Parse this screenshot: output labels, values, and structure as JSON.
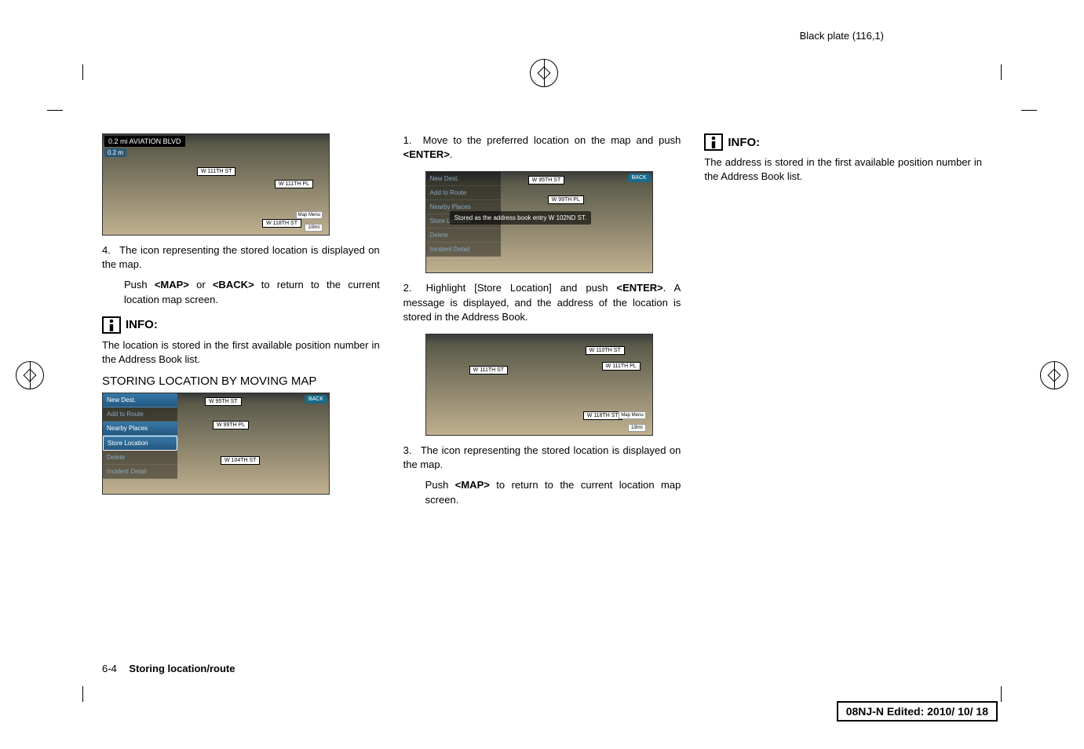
{
  "header": {
    "black_plate": "Black plate (116,1)"
  },
  "col1": {
    "shot1": {
      "hdr": "0.2 mi   AVIATION BLVD",
      "sub": "0.2 m",
      "street1": "W 111TH ST",
      "street2": "W 111TH PL",
      "street3": "W 118TH ST",
      "mapmenu": "Map\nMenu",
      "scale": "1/8mi"
    },
    "step4": {
      "num": "4.",
      "text": "The icon representing the stored location is displayed on the map.",
      "text2a": "Push ",
      "map": "<MAP>",
      "text2b": " or ",
      "back": "<BACK>",
      "text2c": " to return to the current location map screen."
    },
    "info": {
      "label": "INFO:",
      "text": "The location is stored in the first available position number in the Address Book list."
    },
    "heading": "STORING LOCATION BY MOVING MAP",
    "shot2": {
      "menu": {
        "new": "New Dest.",
        "add": "Add to Route",
        "nearby": "Nearby Places",
        "store": "Store Location",
        "delete": "Delete",
        "incident": "Incident Detail"
      },
      "street1": "W 95TH ST",
      "street2": "W 99TH PL",
      "street3": "W 104TH ST",
      "back": "BACK"
    }
  },
  "col2": {
    "step1": {
      "num": "1.",
      "text1": "Move to the preferred location on the map and push ",
      "enter": "<ENTER>",
      "text2": "."
    },
    "shot1": {
      "menu": {
        "new": "New Dest.",
        "add": "Add to Route",
        "near": "Nearby Places",
        "store": "Store Location",
        "delete": "Delete",
        "incident": "Incident Detail"
      },
      "toast": "Stored as the address book entry W 102ND ST.",
      "street1": "W 95TH ST",
      "street2": "W 99TH PL",
      "back": "BACK"
    },
    "step2": {
      "num": "2.",
      "text1": "Highlight [Store Location] and push ",
      "enter": "<ENTER>",
      "text2": ". A message is displayed, and the address of the location is stored in the Address Book."
    },
    "shot2": {
      "street1": "W 110TH ST",
      "street2": "W 111TH ST",
      "street3": "W 111TH PL",
      "street4": "W 118TH ST",
      "mapmenu": "Map\nMenu",
      "scale": "1/8mi"
    },
    "step3": {
      "num": "3.",
      "text": "The icon representing the stored location is displayed on the map.",
      "text2a": "Push ",
      "map": "<MAP>",
      "text2b": " to return to the current location map screen."
    }
  },
  "col3": {
    "info": {
      "label": "INFO:",
      "text": "The address is stored in the first available position number in the Address Book list."
    }
  },
  "footer": {
    "page": "6-4",
    "title": "Storing location/route",
    "stamp": "08NJ-N Edited:  2010/ 10/ 18"
  }
}
